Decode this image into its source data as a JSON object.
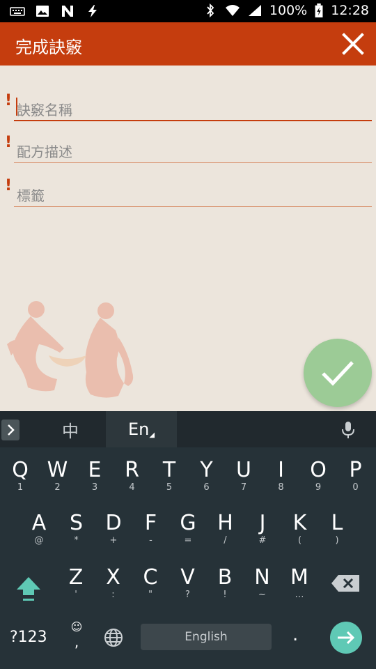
{
  "status_bar": {
    "battery": "100%",
    "time": "12:28"
  },
  "app_bar": {
    "title": "完成訣竅"
  },
  "form": {
    "fields": [
      {
        "placeholder": "訣竅名稱"
      },
      {
        "placeholder": "配方描述"
      },
      {
        "placeholder": "標籤"
      }
    ],
    "required_mark": "!"
  },
  "keyboard": {
    "lang_zh": "中",
    "lang_en": "En",
    "row1": [
      {
        "k": "Q",
        "s": "1"
      },
      {
        "k": "W",
        "s": "2"
      },
      {
        "k": "E",
        "s": "3"
      },
      {
        "k": "R",
        "s": "4"
      },
      {
        "k": "T",
        "s": "5"
      },
      {
        "k": "Y",
        "s": "6"
      },
      {
        "k": "U",
        "s": "7"
      },
      {
        "k": "I",
        "s": "8"
      },
      {
        "k": "O",
        "s": "9"
      },
      {
        "k": "P",
        "s": "0"
      }
    ],
    "row2": [
      {
        "k": "A",
        "s": "@"
      },
      {
        "k": "S",
        "s": "*"
      },
      {
        "k": "D",
        "s": "+"
      },
      {
        "k": "F",
        "s": "-"
      },
      {
        "k": "G",
        "s": "="
      },
      {
        "k": "H",
        "s": "/"
      },
      {
        "k": "J",
        "s": "#"
      },
      {
        "k": "K",
        "s": "("
      },
      {
        "k": "L",
        "s": ")"
      }
    ],
    "row3": [
      {
        "k": "Z",
        "s": "'"
      },
      {
        "k": "X",
        "s": ":"
      },
      {
        "k": "C",
        "s": "\""
      },
      {
        "k": "V",
        "s": "?"
      },
      {
        "k": "B",
        "s": "!"
      },
      {
        "k": "N",
        "s": "~"
      },
      {
        "k": "M",
        "s": "…"
      }
    ],
    "symbols_label": "?123",
    "emoji_symbol": "☺",
    "comma": ",",
    "space_label": "English",
    "period": "."
  }
}
